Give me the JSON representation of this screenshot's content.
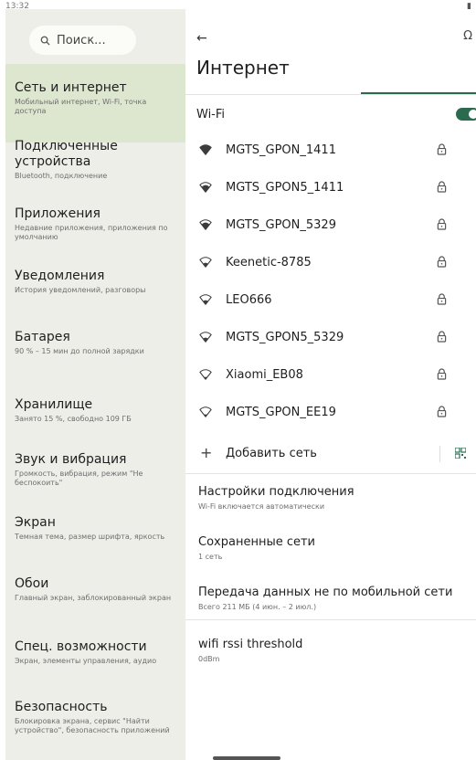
{
  "status": {
    "time": "13:32",
    "battery": "á"
  },
  "search": {
    "placeholder": "Поиск..."
  },
  "sidebar": {
    "items": [
      {
        "title": "Сеть и интернет",
        "subtitle": "Мобильный интернет, Wi-Fi, точка доступа"
      },
      {
        "title": "Подключенные устройства",
        "subtitle": "Bluetooth, подключение"
      },
      {
        "title": "Приложения",
        "subtitle": "Недавние приложения, приложения по умолчанию"
      },
      {
        "title": "Уведомления",
        "subtitle": "История уведомлений, разговоры"
      },
      {
        "title": "Батарея",
        "subtitle": "90 % – 15 мин до полной зарядки"
      },
      {
        "title": "Хранилище",
        "subtitle": "Занято 15 %, свободно 109 ГБ"
      },
      {
        "title": "Звук и вибрация",
        "subtitle": "Громкость, вибрация, режим \"Не беспокоить\""
      },
      {
        "title": "Экран",
        "subtitle": "Темная тема, размер шрифта, яркость"
      },
      {
        "title": "Обои",
        "subtitle": "Главный экран, заблокированный экран"
      },
      {
        "title": "Спец. возможности",
        "subtitle": "Экран, элементы управления, аудио"
      },
      {
        "title": "Безопасность",
        "subtitle": "Блокировка экрана, сервис \"Найти устройство\", безопасность приложений"
      }
    ]
  },
  "main": {
    "title": "Интернет",
    "wifi_label": "Wi-Fi",
    "wifi_enabled": true,
    "networks": [
      {
        "name": "MGTS_GPON_1411",
        "signal": "full"
      },
      {
        "name": "MGTS_GPON5_1411",
        "signal": "high"
      },
      {
        "name": "MGTS_GPON_5329",
        "signal": "high"
      },
      {
        "name": "Keenetic-8785",
        "signal": "medium"
      },
      {
        "name": "LEO666",
        "signal": "medium"
      },
      {
        "name": "MGTS_GPON5_5329",
        "signal": "medium"
      },
      {
        "name": "Xiaomi_EB08",
        "signal": "low"
      },
      {
        "name": "MGTS_GPON_EE19",
        "signal": "low"
      }
    ],
    "add_network": "Добавить сеть",
    "settings": [
      {
        "title": "Настройки подключения",
        "subtitle": "Wi-Fi включается автоматически"
      },
      {
        "title": "Сохраненные сети",
        "subtitle": "1 сеть"
      },
      {
        "title": "Передача данных не по мобильной сети",
        "subtitle": "Всего 211 МБ (4 июн. – 2 июл.)"
      },
      {
        "title": "wifi rssi threshold",
        "subtitle": "0dBm"
      }
    ]
  },
  "colors": {
    "accent": "#2a6b4f",
    "selected_bg": "#dde7d0",
    "sidebar_bg": "#eeeee8"
  },
  "icons": [
    "search-icon",
    "back-arrow-icon",
    "help-icon",
    "wifi-icon",
    "lock-icon",
    "plus-icon",
    "qr-code-icon"
  ]
}
